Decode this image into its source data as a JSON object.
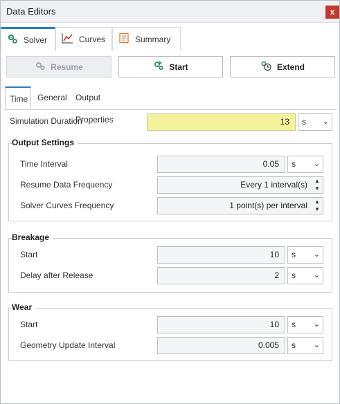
{
  "window": {
    "title": "Data Editors",
    "close_label": "x"
  },
  "top_tabs": [
    {
      "label": "Solver",
      "icon": "gears-icon"
    },
    {
      "label": "Curves",
      "icon": "line-chart-icon"
    },
    {
      "label": "Summary",
      "icon": "document-icon"
    }
  ],
  "toolbar": {
    "resume_label": "Resume",
    "start_label": "Start",
    "extend_label": "Extend"
  },
  "sub_tabs": [
    {
      "label": "Time"
    },
    {
      "label": "General"
    },
    {
      "label": "Output Properties"
    }
  ],
  "simulation_duration": {
    "label": "Simulation Duration",
    "value": "13",
    "unit": "s"
  },
  "output_settings": {
    "title": "Output Settings",
    "time_interval": {
      "label": "Time Interval",
      "value": "0.05",
      "unit": "s"
    },
    "resume_data_frequency": {
      "label": "Resume Data Frequency",
      "value": "Every 1 interval(s)"
    },
    "solver_curves_frequency": {
      "label": "Solver Curves Frequency",
      "value": "1 point(s) per interval"
    }
  },
  "breakage": {
    "title": "Breakage",
    "start": {
      "label": "Start",
      "value": "10",
      "unit": "s"
    },
    "delay_after_release": {
      "label": "Delay after Release",
      "value": "2",
      "unit": "s"
    }
  },
  "wear": {
    "title": "Wear",
    "start": {
      "label": "Start",
      "value": "10",
      "unit": "s"
    },
    "geometry_update_interval": {
      "label": "Geometry Update Interval",
      "value": "0.005",
      "unit": "s"
    }
  },
  "colors": {
    "accent": "#2f7bc2",
    "highlight": "#f4f39b",
    "close": "#c0392b",
    "start_icon": "#2e9b62"
  }
}
